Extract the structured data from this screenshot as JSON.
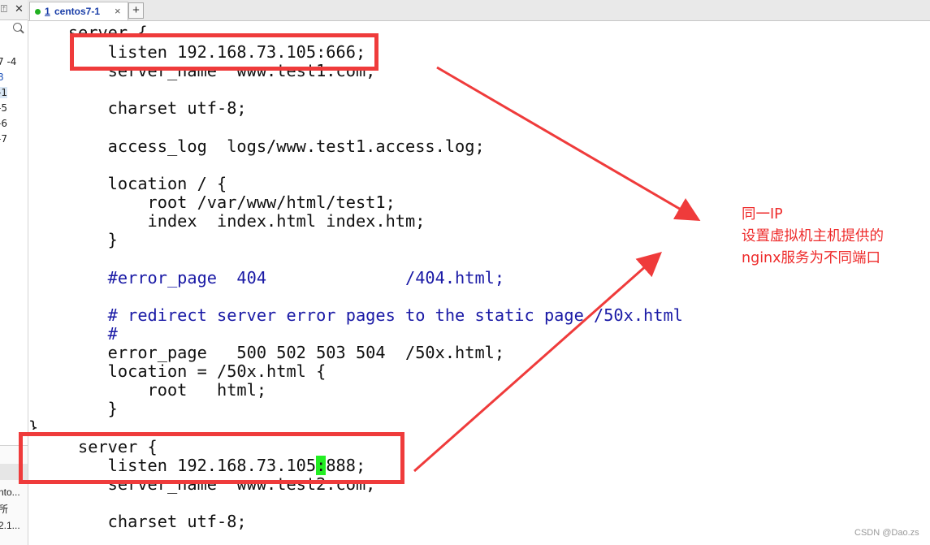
{
  "left_panel": {
    "pin_glyph": "⍐",
    "close_glyph": "✕",
    "sessions": [
      {
        "label": "7 -4"
      },
      {
        "label": "8"
      },
      {
        "label": "-1"
      },
      {
        "label": "-5"
      },
      {
        "label": "-6"
      },
      {
        "label": "-7"
      }
    ],
    "lower_items": [
      {
        "label": "nto..."
      },
      {
        "label": "所"
      },
      {
        "label": "2.1..."
      }
    ]
  },
  "tabs": [
    {
      "number": "1",
      "label": "centos7-1",
      "active": true,
      "status_color": "#21b021"
    }
  ],
  "tab_close_glyph": "×",
  "tab_add_glyph": "+",
  "terminal": {
    "lines": [
      {
        "text": "    server {",
        "type": "normal"
      },
      {
        "text": "        listen 192.168.73.105:666;",
        "type": "normal"
      },
      {
        "text": "        server_name  www.test1.com;",
        "type": "normal"
      },
      {
        "text": "",
        "type": "normal"
      },
      {
        "text": "        charset utf-8;",
        "type": "normal"
      },
      {
        "text": "",
        "type": "normal"
      },
      {
        "text": "        access_log  logs/www.test1.access.log;",
        "type": "normal"
      },
      {
        "text": "",
        "type": "normal"
      },
      {
        "text": "        location / {",
        "type": "normal"
      },
      {
        "text": "            root /var/www/html/test1;",
        "type": "normal"
      },
      {
        "text": "            index  index.html index.htm;",
        "type": "normal"
      },
      {
        "text": "        }",
        "type": "normal"
      },
      {
        "text": "",
        "type": "normal"
      },
      {
        "text": "        #error_page  404              /404.html;",
        "type": "comment"
      },
      {
        "text": "",
        "type": "normal"
      },
      {
        "text": "        # redirect server error pages to the static page /50x.html",
        "type": "comment"
      },
      {
        "text": "        #",
        "type": "comment"
      },
      {
        "text": "        error_page   500 502 503 504  /50x.html;",
        "type": "normal"
      },
      {
        "text": "        location = /50x.html {",
        "type": "normal"
      },
      {
        "text": "            root   html;",
        "type": "normal"
      },
      {
        "text": "        }",
        "type": "normal"
      },
      {
        "text": "}",
        "type": "normal"
      },
      {
        "text": "     server {",
        "type": "normal"
      },
      {
        "text": "        listen 192.168.73.105",
        "type": "normal",
        "cursor": ":",
        "after": "888;"
      },
      {
        "text": "        server_name  www.test2.com;",
        "type": "normal"
      },
      {
        "text": "",
        "type": "normal"
      },
      {
        "text": "        charset utf-8;",
        "type": "normal"
      }
    ]
  },
  "annotation": {
    "lines": [
      "同一IP",
      "设置虚拟机主机提供的",
      "nginx服务为不同端口"
    ],
    "color": "#ee2b2b"
  },
  "watermark": "CSDN @Dao.zs",
  "colors": {
    "highlight": "#ef3b3b",
    "comment": "#1a1aa6",
    "cursor": "#22ee22"
  }
}
